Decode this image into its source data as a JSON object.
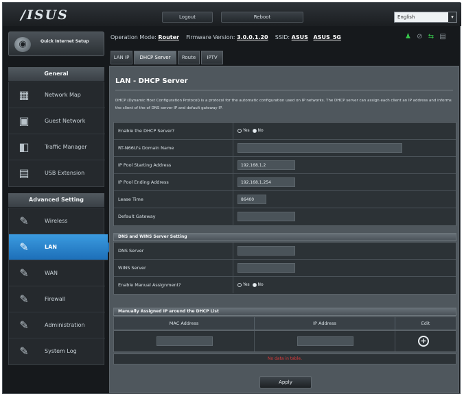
{
  "header": {
    "logo": "/ISUS",
    "logout_label": "Logout",
    "reboot_label": "Reboot",
    "language": "English"
  },
  "quick_setup": {
    "label": "Quick Internet Setup"
  },
  "sidebar": {
    "general_title": "General",
    "general_items": [
      {
        "label": "Network Map",
        "icon": "network-map-icon"
      },
      {
        "label": "Guest Network",
        "icon": "guest-network-icon"
      },
      {
        "label": "Traffic Manager",
        "icon": "traffic-manager-icon"
      },
      {
        "label": "USB Extension",
        "icon": "usb-extension-icon"
      }
    ],
    "advanced_title": "Advanced Setting",
    "advanced_items": [
      {
        "label": "Wireless",
        "icon": "wrench-icon"
      },
      {
        "label": "LAN",
        "icon": "wrench-icon",
        "active": true
      },
      {
        "label": "WAN",
        "icon": "wrench-icon"
      },
      {
        "label": "Firewall",
        "icon": "wrench-icon"
      },
      {
        "label": "Administration",
        "icon": "wrench-icon"
      },
      {
        "label": "System Log",
        "icon": "wrench-icon"
      }
    ]
  },
  "infobar": {
    "operation_mode_label": "Operation Mode:",
    "operation_mode_value": "Router",
    "firmware_label": "Firmware Version:",
    "firmware_value": "3.0.0.1.20",
    "ssid_label": "SSID:",
    "ssid_value_1": "ASUS",
    "ssid_value_2": "ASUS_5G"
  },
  "tabs": [
    "LAN IP",
    "DHCP Server",
    "Route",
    "IPTV"
  ],
  "main": {
    "title": "LAN - DHCP Server",
    "description": "DHCP (Dynamic Host Configuration Protocol) is a protocol for the automatic configuration used on IP networks. The DHCP server can assign each client an IP address and informs the client of the of DNS server IP and default gateway IP.",
    "fields": [
      {
        "label": "Enable the DHCP Server?",
        "type": "radio",
        "yes": "Yes",
        "no": "No",
        "selected": "No"
      },
      {
        "label": "RT-N66U's Domain Name",
        "type": "input",
        "value": ""
      },
      {
        "label": "IP Pool Starting Address",
        "type": "input",
        "value": "192.168.1.2"
      },
      {
        "label": "IP Pool Ending Address",
        "type": "input",
        "value": "192.168.1.254"
      },
      {
        "label": "Lease Time",
        "type": "input",
        "value": "86400"
      },
      {
        "label": "Default Gateway",
        "type": "input",
        "value": ""
      }
    ],
    "dns_section_title": "DNS and WINS Server Setting",
    "dns_fields": [
      {
        "label": "DNS Server",
        "value": ""
      },
      {
        "label": "WINS Server",
        "value": ""
      },
      {
        "label": "Enable Manual Assignment?",
        "type": "radio",
        "yes": "Yes",
        "no": "No",
        "selected": "No"
      }
    ],
    "manual_section_title": "Manually Assigned IP around the DHCP List",
    "list_headers": {
      "mac": "MAC Address",
      "ip": "IP Address",
      "edit": "Edit"
    },
    "no_data": "No data in table.",
    "apply_label": "Apply"
  }
}
